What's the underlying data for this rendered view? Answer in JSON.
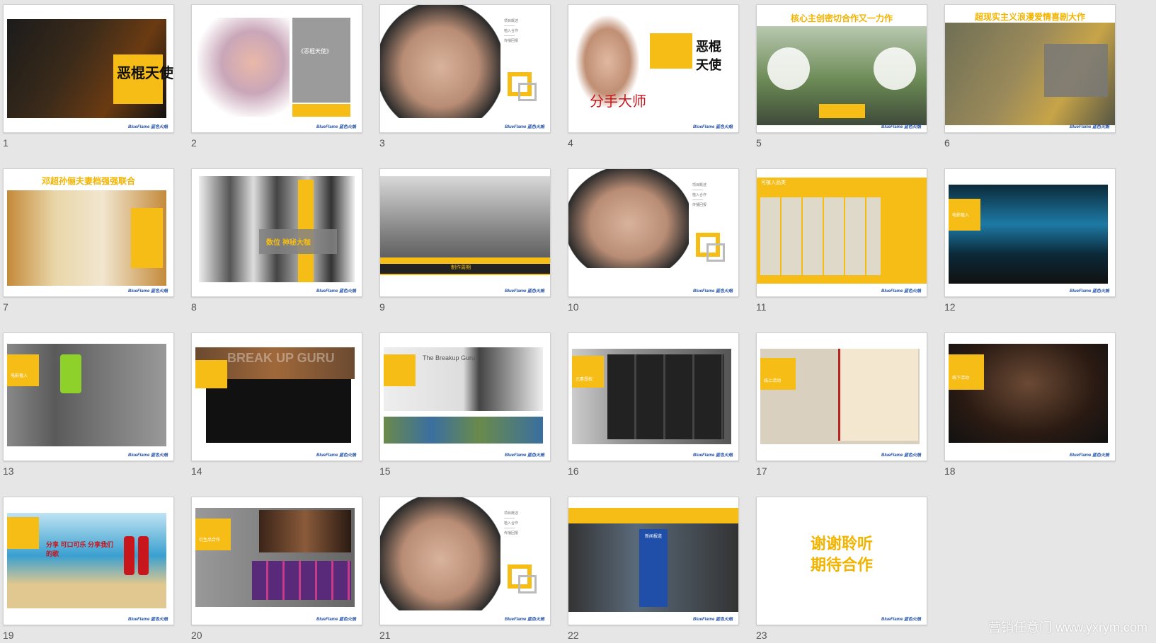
{
  "slides": [
    {
      "number": "1",
      "title": "恶棍天使"
    },
    {
      "number": "2",
      "title": "《恶棍天使》"
    },
    {
      "number": "3",
      "title": ""
    },
    {
      "number": "4",
      "title": "恶棍天使",
      "subtitle": "分手大师"
    },
    {
      "number": "5",
      "title": "核心主创密切合作又一力作"
    },
    {
      "number": "6",
      "title": "超现实主义浪漫爱情喜剧大作"
    },
    {
      "number": "7",
      "title": "邓超孙俪夫妻档强强联合"
    },
    {
      "number": "8",
      "title": "数位 神秘大咖"
    },
    {
      "number": "9",
      "title": "制作周期"
    },
    {
      "number": "10",
      "title": ""
    },
    {
      "number": "11",
      "title": "可植入品类"
    },
    {
      "number": "12",
      "title": "电影植入"
    },
    {
      "number": "13",
      "title": "电影植入"
    },
    {
      "number": "14",
      "title": "BREAK UP GURU"
    },
    {
      "number": "15",
      "title": "The Breakup Guru"
    },
    {
      "number": "16",
      "title": "元素授权"
    },
    {
      "number": "17",
      "title": "线上活动"
    },
    {
      "number": "18",
      "title": "线下活动"
    },
    {
      "number": "19",
      "title": "分享 可口可乐 分享我们的歌"
    },
    {
      "number": "20",
      "title": "衍生品合作"
    },
    {
      "number": "21",
      "title": ""
    },
    {
      "number": "22",
      "title": "新闻报道"
    },
    {
      "number": "23",
      "title": "谢谢聆听",
      "subtitle": "期待合作"
    }
  ],
  "brand": "BlueFlame 蓝色火焰",
  "watermark": "营销任意门 www.yxrym.com",
  "colors": {
    "accent": "#f6bd16",
    "background": "#e6e6e6",
    "brand_blue": "#1f4fa8"
  }
}
